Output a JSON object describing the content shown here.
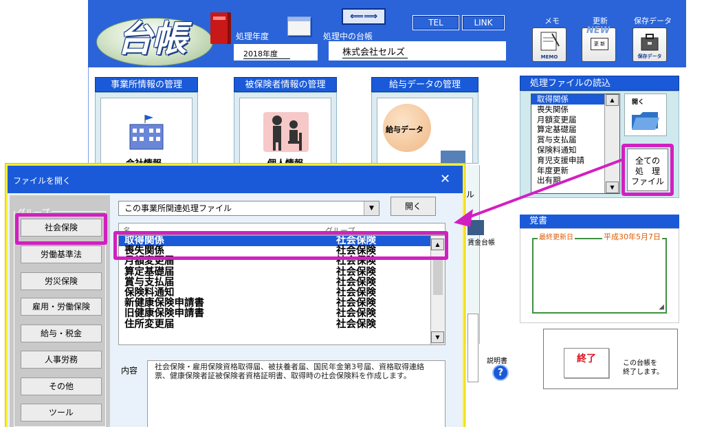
{
  "app": {
    "logo_text": "台帳",
    "fiscal_year_label": "処理年度",
    "fiscal_year": "2018年度",
    "ledger_label": "処理中の台帳",
    "company": "株式会社セルズ",
    "tel_label": "TEL",
    "link_label": "LINK",
    "top_icons": [
      {
        "label": "メモ",
        "caption": "MEMO",
        "icon": "memo-icon"
      },
      {
        "label": "更新",
        "caption": "更 新",
        "badge": "NEW",
        "icon": "update-icon"
      },
      {
        "label": "保存データ",
        "caption": "保存データ",
        "icon": "briefcase-icon"
      }
    ]
  },
  "sections": {
    "office": {
      "title": "事業所情報の管理",
      "card_label": "会社情報"
    },
    "insured": {
      "title": "被保険者情報の管理",
      "card_label": "個人情報"
    },
    "salary": {
      "title": "給与データの管理",
      "card_label": "給与データ"
    },
    "wage_ledger_label": "賃金台帳",
    "manual_label": "説明書",
    "hidden_label_fragment": "ル"
  },
  "file_panel": {
    "title": "処理ファイルの読込",
    "items": [
      "取得関係",
      "喪失関係",
      "月額変更届",
      "算定基礎届",
      "賞与支払届",
      "保険料通知",
      "育児支援申請",
      "年度更新",
      "出有期"
    ],
    "selected_index": 0,
    "open_label": "開く",
    "all_files_label": [
      "全ての",
      "処　理",
      "ファイル"
    ]
  },
  "memo": {
    "title": "覚書",
    "last_updated_label": "最終更新日",
    "last_updated": "平成30年5月7日"
  },
  "exit": {
    "button_label": "終了",
    "note": [
      "この台帳を",
      "終了します。"
    ]
  },
  "dialog": {
    "title": "ファイルを開く",
    "close": "✕",
    "group_label": "グループ",
    "groups": [
      "社会保険",
      "労働基準法",
      "労災保険",
      "雇用・労働保険",
      "給与・税金",
      "人事労務",
      "その他",
      "ツール"
    ],
    "selected_group_index": 0,
    "combo_value": "この事業所関連処理ファイル",
    "open_button": "開く",
    "list_header_fragments": [
      "名",
      "グループ"
    ],
    "rows": [
      {
        "name": "取得関係",
        "group": "社会保険"
      },
      {
        "name": "喪失関係",
        "group": "社会保険"
      },
      {
        "name": "月額変更届",
        "group": "社会保険"
      },
      {
        "name": "算定基礎届",
        "group": "社会保険"
      },
      {
        "name": "賞与支払届",
        "group": "社会保険"
      },
      {
        "name": "保険料通知",
        "group": "社会保険"
      },
      {
        "name": "新健康保険申請書",
        "group": "社会保険"
      },
      {
        "name": "旧健康保険申請書",
        "group": "社会保険"
      },
      {
        "name": "住所変更届",
        "group": "社会保険"
      }
    ],
    "selected_row_index": 0,
    "content_label": "内容",
    "content_text": "社会保険・雇用保険資格取得届、被扶養者届、国民年金第3号届、資格取得連絡票、健康保険者証被保険者資格証明書、取得時の社会保険料を作成します。"
  },
  "colors": {
    "header_blue": "#2a64d8",
    "highlight_magenta": "#d21fc1",
    "dialog_border_yellow": "#ffee33",
    "exit_red": "#e0101c",
    "memo_date_orange": "#e05a00"
  }
}
